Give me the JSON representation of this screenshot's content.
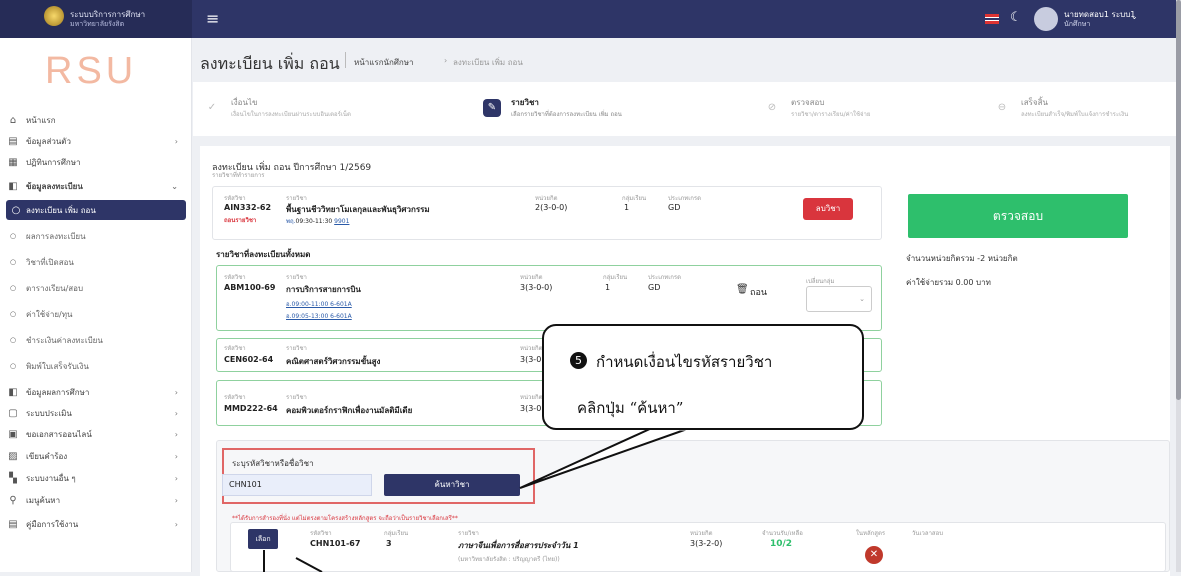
{
  "topbar": {
    "brand_line1": "ระบบบริการการศึกษา",
    "brand_line2": "มหาวิทยาลัยรังสิต",
    "user_name": "นายทดสอบ1 ระบบ1",
    "user_role": "นักศึกษา"
  },
  "sidebar": {
    "logo_text": "RSU",
    "items": [
      {
        "label": "หน้าแรก",
        "icon": "home-icon",
        "glyph": "⌂"
      },
      {
        "label": "ข้อมูลส่วนตัว",
        "icon": "id-card-icon",
        "glyph": "▤"
      },
      {
        "label": "ปฏิทินการศึกษา",
        "icon": "calendar-icon",
        "glyph": "▦"
      },
      {
        "label": "ข้อมูลลงทะเบียน",
        "icon": "register-icon",
        "glyph": "◧"
      },
      {
        "label": "ลงทะเบียน เพิ่ม ถอน",
        "icon": "circle-icon",
        "glyph": "○"
      },
      {
        "label": "ผลการลงทะเบียน",
        "icon": "circle-icon",
        "glyph": "○"
      },
      {
        "label": "วิชาที่เปิดสอน",
        "icon": "circle-icon",
        "glyph": "○"
      },
      {
        "label": "ตารางเรียน/สอบ",
        "icon": "circle-icon",
        "glyph": "○"
      },
      {
        "label": "ค่าใช้จ่าย/ทุน",
        "icon": "circle-icon",
        "glyph": "○"
      },
      {
        "label": "ชำระเงินค่าลงทะเบียน",
        "icon": "circle-icon",
        "glyph": "○"
      },
      {
        "label": "พิมพ์ใบเสร็จรับเงิน",
        "icon": "circle-icon",
        "glyph": "○"
      },
      {
        "label": "ข้อมูลผลการศึกษา",
        "icon": "grades-icon",
        "glyph": "◧"
      },
      {
        "label": "ระบบประเมิน",
        "icon": "evaluation-icon",
        "glyph": "▢"
      },
      {
        "label": "ขอเอกสารออนไลน์",
        "icon": "document-icon",
        "glyph": "▣"
      },
      {
        "label": "เขียนคำร้อง",
        "icon": "petition-icon",
        "glyph": "▨"
      },
      {
        "label": "ระบบงานอื่น ๆ",
        "icon": "apps-icon",
        "glyph": "▚"
      },
      {
        "label": "เมนูค้นหา",
        "icon": "search-icon",
        "glyph": "⚲"
      },
      {
        "label": "คู่มือการใช้งาน",
        "icon": "manual-icon",
        "glyph": "▤"
      }
    ]
  },
  "header": {
    "title": "ลงทะเบียน เพิ่ม ถอน",
    "crumb_home": "หน้าแรกนักศึกษา",
    "crumb_sep": "›",
    "crumb_current": "ลงทะเบียน เพิ่ม ถอน"
  },
  "steps": [
    {
      "title": "เงื่อนไข",
      "desc": "เงื่อนไขในการลงทะเบียนผ่านระบบอินเตอร์เน็ต",
      "glyph": "✓"
    },
    {
      "title": "รายวิชา",
      "desc": "เลือกรายวิชาที่ต้องการลงทะเบียน เพิ่ม ถอน",
      "glyph": "✎"
    },
    {
      "title": "ตรวจสอบ",
      "desc": "รายวิชา/ตารางเรียน/ค่าใช้จ่าย",
      "glyph": "⊘"
    },
    {
      "title": "เสร็จสิ้น",
      "desc": "ลงทะเบียนสำเร็จ/พิมพ์ใบแจ้งการชำระเงิน",
      "glyph": "⊖"
    }
  ],
  "term": {
    "heading": "ลงทะเบียน เพิ่ม ถอน ปีการศึกษา 1/2569",
    "sub": "รายวิชาที่ทำรายการ"
  },
  "labels": {
    "code": "รหัสวิชา",
    "name": "รายวิชา",
    "credit": "หน่วยกิต",
    "section": "กลุ่มเรียน",
    "grade_type": "ประเภทเกรด",
    "change_section": "เปลี่ยนกลุ่ม",
    "seats": "จำนวนรับ/เหลือ",
    "in_curriculum": "ในหลักสูตร",
    "exam_date": "วันเวลาสอบ"
  },
  "pending_course": {
    "code": "AIN332-62",
    "status": "ถอนรายวิชา",
    "name": "พื้นฐานชีววิทยาโมเลกุลและพันธุวิศวกรรม",
    "schedule_day": "พฤ.",
    "schedule_time": "09:30-11:30",
    "room": "9901",
    "credit": "2(3-0-0)",
    "section": "1",
    "grade_type": "GD",
    "drop_label": "ลบวิชา"
  },
  "summary": {
    "check_button": "ตรวจสอบ",
    "credit_total": "จำนวนหน่วยกิตรวม -2 หน่วยกิต",
    "cost_total": "ค่าใช้จ่ายรวม 0.00 บาท"
  },
  "all_registered_heading": "รายวิชาที่ลงทะเบียนทั้งหมด",
  "registered": [
    {
      "code": "ABM100-69",
      "name": "การบริการสายการบิน",
      "credit": "3(3-0-0)",
      "section": "1",
      "grade_type": "GD",
      "times": [
        "อ.09:00-11:00 6-601A",
        "อ.09:05-13:00 6-601A"
      ],
      "withdraw": "ถอน",
      "select_placeholder": "⌄"
    },
    {
      "code": "CEN602-64",
      "name": "คณิตศาสตร์วิศวกรรมขั้นสูง",
      "credit": "3(3-0"
    },
    {
      "code": "MMD222-64",
      "name": "คอมพิวเตอร์กราฟิกเพื่องานมัลติมีเดีย",
      "credit": "3(3-0"
    }
  ],
  "search": {
    "label": "ระบุรหัสวิชาหรือชื่อวิชา",
    "value": "CHN101",
    "button": "ค้นหาวิชา"
  },
  "note": "**ได้รับการสำรองที่นั่ง แต่ไม่ตรงตามโครงสร้างหลักสูตร จะถือว่าเป็นรายวิชาเลือกเสรี**",
  "result": {
    "choose": "เลือก",
    "code": "CHN101-67",
    "section": "3",
    "name": "ภาษาจีนเพื่อการสื่อสารประจำวัน 1",
    "faculty": "(มหาวิทยาลัยรังสิต : ปริญญาตรี (ไทย))",
    "credit": "3(3-2-0)",
    "seats": "10/2"
  },
  "callout": {
    "step_number": "5",
    "line1": "กำหนดเงื่อนไขรหัสรายวิชา",
    "line2": "คลิกปุ่ม “ค้นหา”"
  }
}
